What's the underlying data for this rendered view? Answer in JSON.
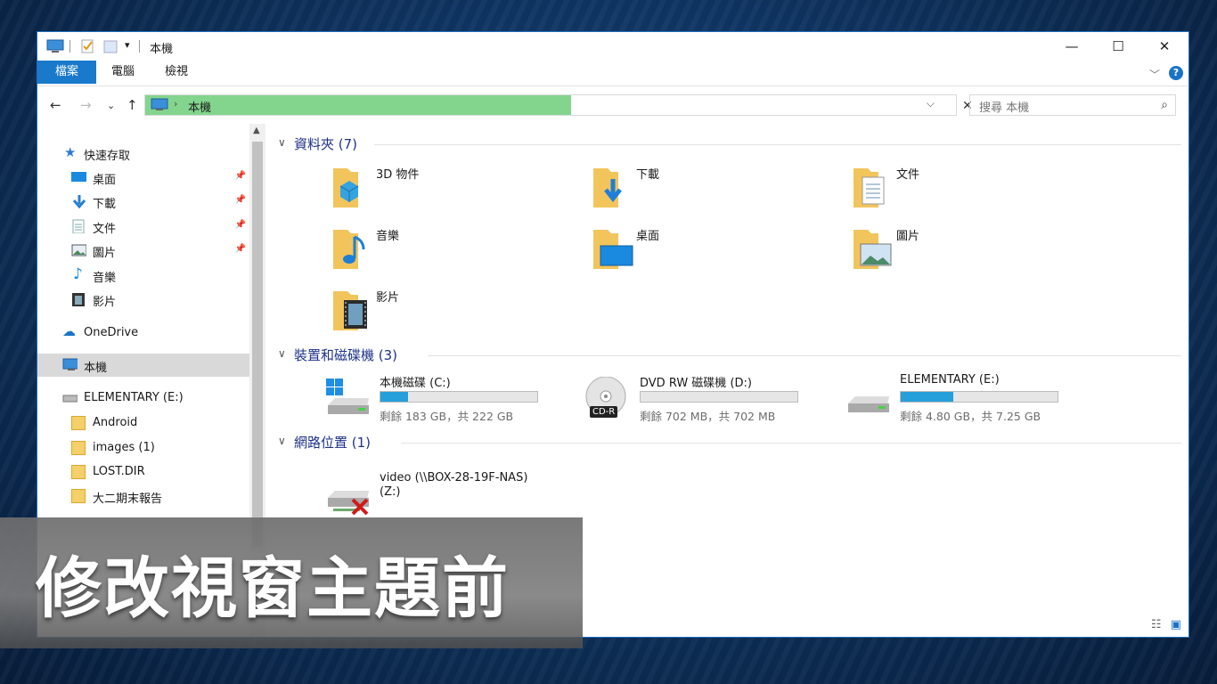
{
  "window": {
    "title": "本機",
    "buttons": {
      "minimize": "—",
      "maximize": "☐",
      "close": "✕"
    }
  },
  "ribbon": {
    "tabs": [
      "檔案",
      "電腦",
      "檢視"
    ],
    "help": "?"
  },
  "address": {
    "path": "本機",
    "search_placeholder": "搜尋 本機"
  },
  "nav": {
    "quick_access": "快速存取",
    "quick_items": [
      {
        "label": "桌面",
        "icon": "desktop-icon",
        "pinned": true
      },
      {
        "label": "下載",
        "icon": "download-icon",
        "pinned": true
      },
      {
        "label": "文件",
        "icon": "document-icon",
        "pinned": true
      },
      {
        "label": "圖片",
        "icon": "picture-icon",
        "pinned": true
      },
      {
        "label": "音樂",
        "icon": "music-icon",
        "pinned": false
      },
      {
        "label": "影片",
        "icon": "video-icon",
        "pinned": false
      }
    ],
    "onedrive": "OneDrive",
    "this_pc": "本機",
    "drive": "ELEMENTARY (E:)",
    "drive_folders": [
      "Android",
      "images (1)",
      "LOST.DIR",
      "大二期末報告"
    ]
  },
  "groups": {
    "folders_title": "資料夾 (7)",
    "devices_title": "裝置和磁碟機 (3)",
    "network_title": "網路位置 (1)"
  },
  "folders": [
    {
      "label": "3D 物件",
      "icon": "3d-objects-icon"
    },
    {
      "label": "下載",
      "icon": "download-folder-icon"
    },
    {
      "label": "文件",
      "icon": "documents-folder-icon"
    },
    {
      "label": "音樂",
      "icon": "music-folder-icon"
    },
    {
      "label": "桌面",
      "icon": "desktop-folder-icon"
    },
    {
      "label": "圖片",
      "icon": "pictures-folder-icon"
    },
    {
      "label": "影片",
      "icon": "videos-folder-icon"
    }
  ],
  "drives": [
    {
      "label": "本機磁碟 (C:)",
      "free": "剩餘 183 GB，共 222 GB",
      "used_fraction": 0.176,
      "icon": "windows-drive-icon"
    },
    {
      "label": "DVD RW 磁碟機 (D:)",
      "free": "剩餘 702 MB，共 702 MB",
      "used_fraction": 0,
      "icon": "cd-drive-icon",
      "badge": "CD-R"
    },
    {
      "label": "ELEMENTARY (E:)",
      "free": "剩餘 4.80 GB，共 7.25 GB",
      "used_fraction": 0.338,
      "icon": "usb-drive-icon"
    }
  ],
  "network": [
    {
      "label_line1": "video (\\\\BOX-28-19F-NAS)",
      "label_line2": "(Z:)",
      "icon": "disconnected-network-drive-icon"
    }
  ],
  "caption": "修改視窗主題前",
  "colors": {
    "accent": "#1979ca",
    "address_highlight": "#83d58d",
    "drive_bar": "#26a0da"
  }
}
